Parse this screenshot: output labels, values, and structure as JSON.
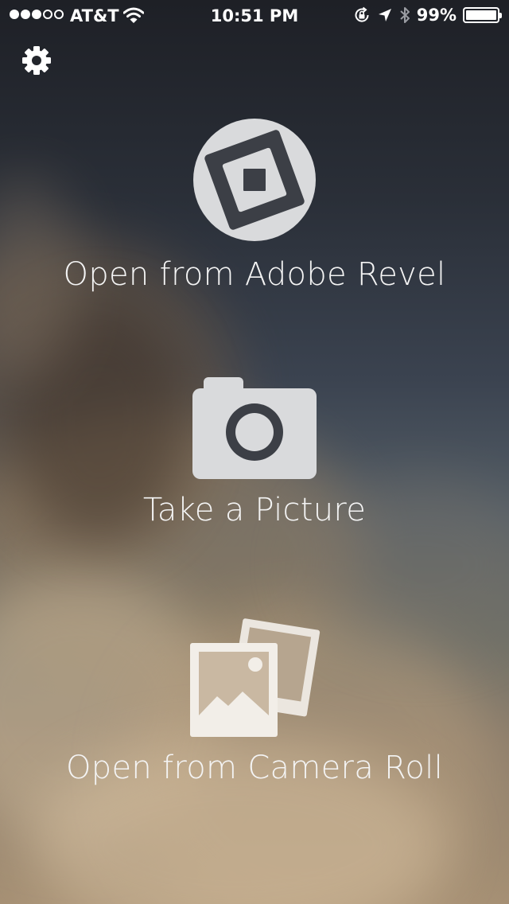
{
  "status_bar": {
    "carrier": "AT&T",
    "time": "10:51 PM",
    "battery_percent": "99%",
    "battery_level": 0.99,
    "signal_bars_filled": 3,
    "signal_bars_total": 5,
    "icons": [
      "signal-dots-icon",
      "wifi-icon",
      "rotation-lock-icon",
      "location-arrow-icon",
      "bluetooth-icon",
      "battery-icon"
    ]
  },
  "toolbar": {
    "settings_icon": "gear-icon"
  },
  "actions": {
    "revel": {
      "label": "Open from Adobe Revel",
      "icon": "adobe-revel-icon"
    },
    "camera": {
      "label": "Take a Picture",
      "icon": "camera-icon"
    },
    "camera_roll": {
      "label": "Open from Camera Roll",
      "icon": "photos-icon"
    }
  },
  "colors": {
    "icon_fill": "#d9dadc",
    "icon_cutout": "#3c3f46",
    "text": "#f4f4f4"
  }
}
